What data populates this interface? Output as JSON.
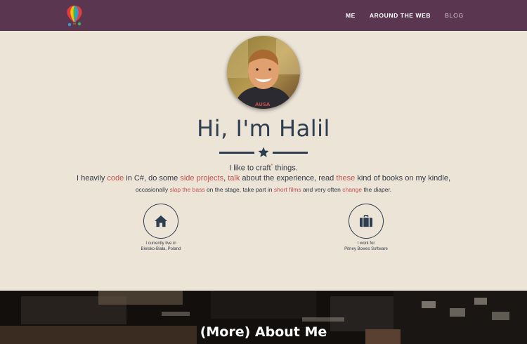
{
  "nav": {
    "items": [
      {
        "label": "ME"
      },
      {
        "label": "AROUND THE WEB"
      },
      {
        "label": "BLOG"
      }
    ]
  },
  "hero": {
    "title": "Hi, I'm Halil",
    "line1": {
      "before": "I like to craft",
      "mark": "*",
      "after": " things."
    },
    "line2": {
      "t1": "I heavily ",
      "l1": "code",
      "t2": " in C#, do some ",
      "l2": "side projects",
      "t3": ", ",
      "l3": "talk",
      "t4": " about the experience, read ",
      "l4": "these",
      "t5": " kind of books on my kindle,"
    },
    "line3": {
      "t1": "occasionally ",
      "l1": "slap the bass",
      "t2": " on the stage, take part in ",
      "l2": "short films",
      "t3": " and very often ",
      "l3": "change",
      "t4": " the diaper."
    }
  },
  "info": {
    "home": {
      "icon": "home-icon",
      "line1": "I currently live in",
      "line2": "Bielsko-Biała, Poland"
    },
    "work": {
      "icon": "briefcase-icon",
      "line1": "I work for",
      "line2": "Pitney Bowes Software"
    }
  },
  "about": {
    "title": "(More) About Me"
  },
  "colors": {
    "nav_bg": "#5b3650",
    "page_bg": "#ede4d8",
    "accent": "#c0504d",
    "text_dark": "#2c3e50"
  }
}
